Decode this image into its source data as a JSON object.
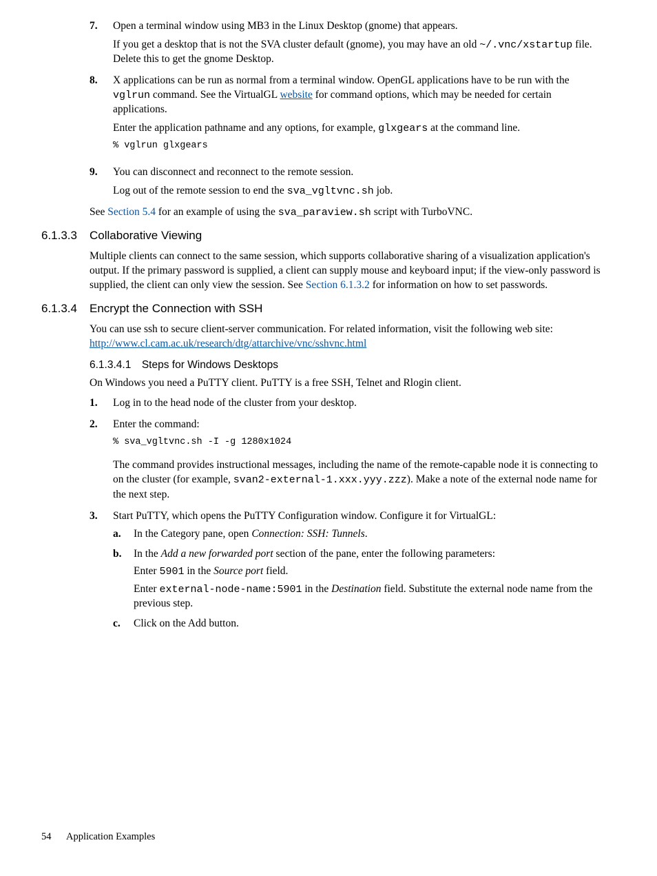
{
  "steps": {
    "s7": {
      "num": "7.",
      "p1a": "Open a terminal window using MB3 in the Linux Desktop (gnome) that appears.",
      "p2a": "If you get a desktop that is not the SVA cluster default (gnome), you may have an old ",
      "p2code": "~/.vnc/xstartup",
      "p2b": " file. Delete this to get the gnome Desktop."
    },
    "s8": {
      "num": "8.",
      "p1a": "X applications can be run as normal from a terminal window. OpenGL applications have to be run with the ",
      "p1code": "vglrun",
      "p1b": " command. See the VirtualGL ",
      "p1link": "website",
      "p1c": " for command options, which may be needed for certain applications.",
      "p2a": "Enter the application pathname and any options, for example, ",
      "p2code": "glxgears",
      "p2b": " at the command line.",
      "cmd": "% vglrun glxgears"
    },
    "s9": {
      "num": "9.",
      "p1": "You can disconnect and reconnect to the remote session.",
      "p2a": "Log out of the remote session to end the ",
      "p2code": "sva_vgltvnc.sh",
      "p2b": " job."
    }
  },
  "afterlist": {
    "a": "See ",
    "xref": "Section 5.4",
    "b": " for an example of using the ",
    "code": "sva_paraview.sh",
    "c": " script with TurboVNC."
  },
  "h6133": {
    "num": "6.1.3.3",
    "title": "Collaborative Viewing",
    "p1a": "Multiple clients can connect to the same session, which supports collaborative sharing of a visualization application's output. If the primary password is supplied, a client can supply mouse and keyboard input; if the view-only password is supplied, the client can only view the session. See ",
    "xref": "Section 6.1.3.2",
    "p1b": " for information on how to set passwords."
  },
  "h6134": {
    "num": "6.1.3.4",
    "title": "Encrypt the Connection with SSH",
    "p1a": "You can use ssh to secure client-server communication. For related information, visit the following web site: ",
    "link": "http://www.cl.cam.ac.uk/research/dtg/attarchive/vnc/sshvnc.html"
  },
  "h61341": {
    "title": "6.1.3.4.1 Steps for Windows Desktops",
    "intro": "On Windows you need a PuTTY client. PuTTY is a free SSH, Telnet and Rlogin client."
  },
  "winsteps": {
    "s1": {
      "num": "1.",
      "text": "Log in to the head node of the cluster from your desktop."
    },
    "s2": {
      "num": "2.",
      "text": "Enter the command:",
      "cmd": "% sva_vgltvnc.sh -I -g 1280x1024",
      "p2a": "The command provides instructional messages, including the name of the remote-capable node it is connecting to on the cluster (for example, ",
      "p2code": "svan2-external-1.xxx.yyy.zzz",
      "p2b": "). Make a note of the external node name for the next step."
    },
    "s3": {
      "num": "3.",
      "text": "Start PuTTY, which opens the PuTTY Configuration window. Configure it for VirtualGL:",
      "a": {
        "num": "a.",
        "t1": "In the Category pane, open ",
        "it": "Connection: SSH: Tunnels",
        "t2": "."
      },
      "b": {
        "num": "b.",
        "t1": "In the ",
        "it1": "Add a new forwarded port",
        "t2": " section of the pane, enter the following parameters:",
        "l1a": "Enter ",
        "l1code": "5901",
        "l1b": " in the ",
        "l1it": "Source port",
        "l1c": " field.",
        "l2a": "Enter ",
        "l2code": "external-node-name:5901",
        "l2b": " in the ",
        "l2it": "Destination",
        "l2c": " field. Substitute the external node name from the previous step."
      },
      "c": {
        "num": "c.",
        "text": "Click on the Add button."
      }
    }
  },
  "footer": {
    "page": "54",
    "chapter": "Application Examples"
  }
}
